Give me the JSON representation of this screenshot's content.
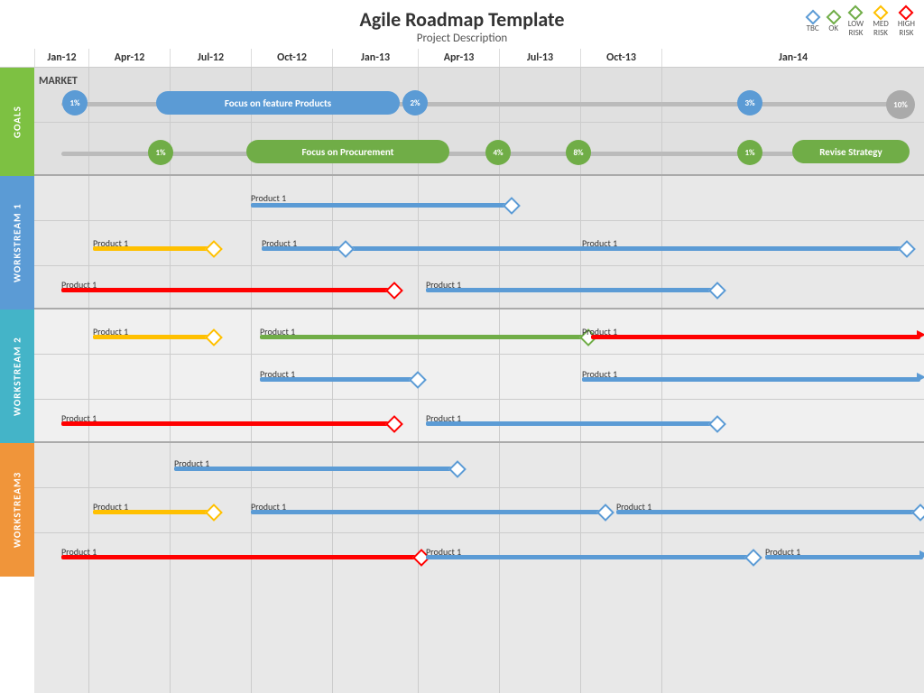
{
  "header": {
    "title": "Agile Roadmap Template",
    "subtitle": "Project Description"
  },
  "legend": {
    "items": [
      {
        "label": "TBC",
        "type": "tbc"
      },
      {
        "label": "OK",
        "type": "ok"
      },
      {
        "label": "LOW\nRISK",
        "type": "low"
      },
      {
        "label": "MED\nRISK",
        "type": "med"
      },
      {
        "label": "HIGH\nRISK",
        "type": "high"
      }
    ]
  },
  "timeline": {
    "columns": [
      "Jan-12",
      "Apr-12",
      "Jul-12",
      "Oct-12",
      "Jan-13",
      "Apr-13",
      "Jul-13",
      "Oct-13",
      "Jan-14"
    ]
  },
  "sidebar": {
    "goals": "GOALS",
    "ws1": "WORKSTREAM 1",
    "ws2": "WORKSTREAM 2",
    "ws3": "WORKSTREAM3"
  },
  "goals": {
    "market_label": "MARKET",
    "row1_pill": "Focus on feature Products",
    "row1_pct1": "1%",
    "row1_pct2": "2%",
    "row1_pct3": "3%",
    "row1_pct4": "10%",
    "row2_pill": "Focus on Procurement",
    "row2_pct1": "1%",
    "row2_pct2": "4%",
    "row2_pct3": "8%",
    "row2_pct4": "1%",
    "row2_pill2": "Revise Strategy"
  },
  "product_label": "Product 1"
}
